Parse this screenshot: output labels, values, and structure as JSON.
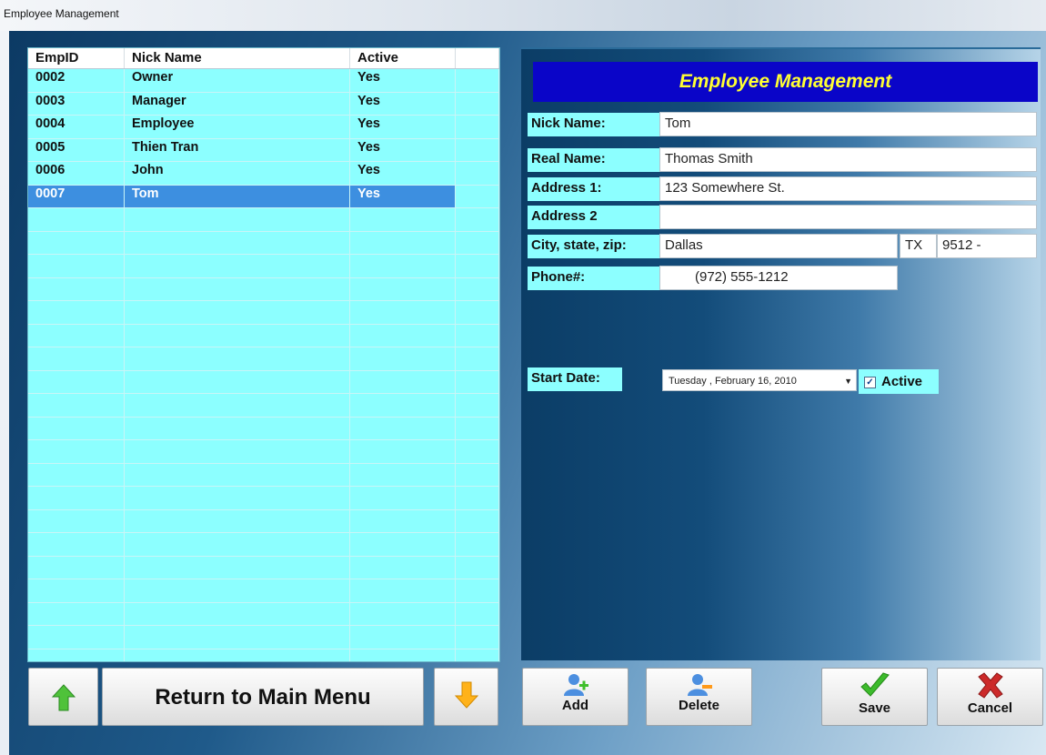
{
  "window": {
    "title": "Employee Management"
  },
  "grid": {
    "columns": [
      "EmpID",
      "Nick Name",
      "Active"
    ],
    "rows": [
      {
        "id": "0002",
        "name": "Owner",
        "active": "Yes"
      },
      {
        "id": "0003",
        "name": "Manager",
        "active": "Yes"
      },
      {
        "id": "0004",
        "name": "Employee",
        "active": "Yes"
      },
      {
        "id": "0005",
        "name": "Thien Tran",
        "active": "Yes"
      },
      {
        "id": "0006",
        "name": "John",
        "active": "Yes"
      },
      {
        "id": "0007",
        "name": "Tom",
        "active": "Yes"
      }
    ],
    "selected_index": 5
  },
  "form": {
    "title": "Employee Management",
    "nick_label": "Nick Name:",
    "nick_value": "Tom",
    "real_label": "Real Name:",
    "real_value": "Thomas Smith",
    "addr1_label": "Address 1:",
    "addr1_value": "123 Somewhere St.",
    "addr2_label": "Address 2",
    "addr2_value": "",
    "city_label": "City, state, zip:",
    "city_value": "Dallas",
    "state_value": "TX",
    "zip_value": "9512 -",
    "phone_label": "Phone#:",
    "phone_value": "(972) 555-1212",
    "start_label": "Start Date:",
    "start_value": "Tuesday ,  February  16, 2010",
    "active_label": "Active",
    "active_checked": true
  },
  "buttons": {
    "return_label": "Return to Main Menu",
    "add_label": "Add",
    "delete_label": "Delete",
    "save_label": "Save",
    "cancel_label": "Cancel"
  },
  "colors": {
    "grid_bg": "#8cffff",
    "selection": "#3d8fe0",
    "title_bg": "#0a05c8",
    "title_text": "#ffff33"
  },
  "icons": {
    "up": "arrow-up-icon",
    "down": "arrow-down-icon",
    "add": "add-user-icon",
    "delete": "delete-user-icon",
    "save": "checkmark-icon",
    "cancel": "x-icon"
  }
}
